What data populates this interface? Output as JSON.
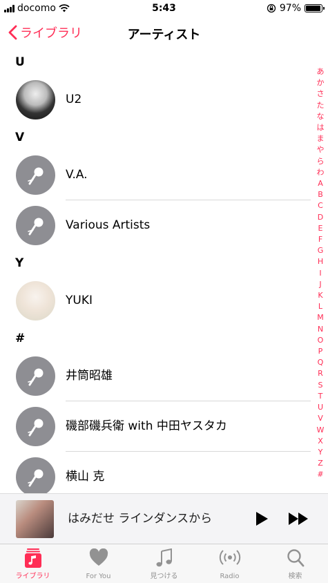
{
  "status_bar": {
    "carrier": "docomo",
    "time": "5:43",
    "battery_percent": "97%",
    "battery_level": 0.97
  },
  "nav": {
    "back_label": "ライブラリ",
    "title": "アーティスト"
  },
  "sections": [
    {
      "header": "U",
      "artists": [
        "U2"
      ]
    },
    {
      "header": "V",
      "artists": [
        "V.A.",
        "Various Artists"
      ]
    },
    {
      "header": "Y",
      "artists": [
        "YUKI"
      ]
    },
    {
      "header": "#",
      "artists": [
        "井筒昭雄",
        "磯部磯兵衛 with 中田ヤスタカ",
        "横山 克"
      ]
    }
  ],
  "index_letters": [
    "あ",
    "か",
    "さ",
    "た",
    "な",
    "は",
    "ま",
    "や",
    "ら",
    "わ",
    "A",
    "B",
    "C",
    "D",
    "E",
    "F",
    "G",
    "H",
    "I",
    "J",
    "K",
    "L",
    "M",
    "N",
    "O",
    "P",
    "Q",
    "R",
    "S",
    "T",
    "U",
    "V",
    "W",
    "X",
    "Y",
    "Z",
    "#"
  ],
  "mini_player": {
    "title": "はみだせ ラインダンスから"
  },
  "tab_bar": {
    "tabs": [
      {
        "label": "ライブラリ",
        "icon": "library-icon",
        "active": true
      },
      {
        "label": "For You",
        "icon": "heart-icon",
        "active": false
      },
      {
        "label": "見つける",
        "icon": "music-note-icon",
        "active": false
      },
      {
        "label": "Radio",
        "icon": "radio-icon",
        "active": false
      },
      {
        "label": "検索",
        "icon": "search-icon",
        "active": false
      }
    ]
  },
  "colors": {
    "accent": "#ff2d55",
    "placeholder_avatar": "#8e8e93"
  }
}
